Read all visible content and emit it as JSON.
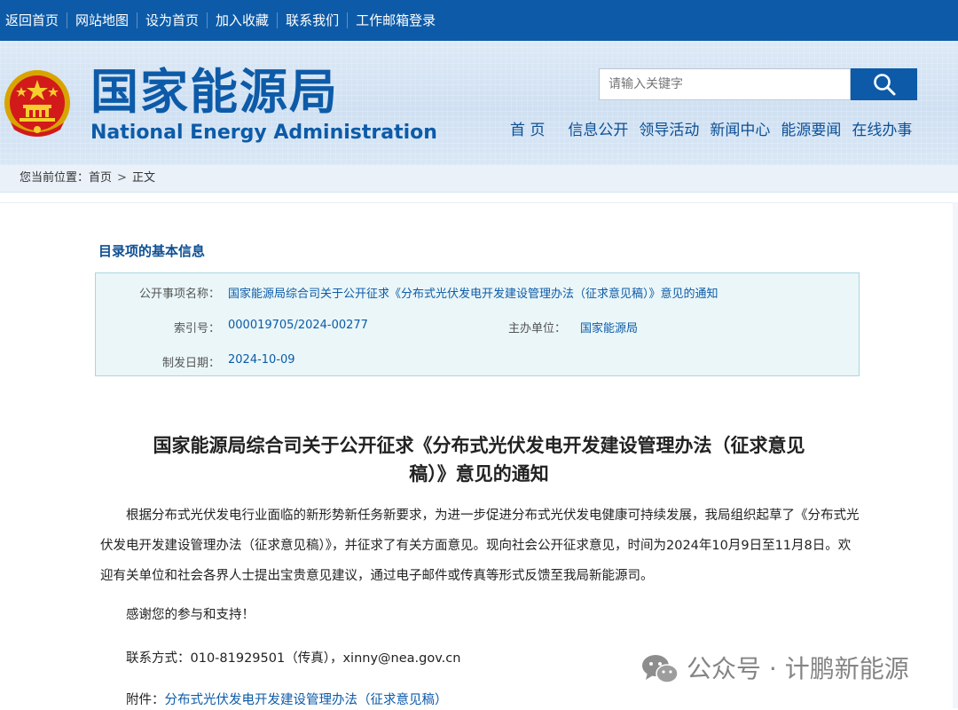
{
  "topbar": {
    "links": [
      "返回首页",
      "网站地图",
      "设为首页",
      "加入收藏",
      "联系我们",
      "工作邮箱登录"
    ]
  },
  "header": {
    "title_cn": "国家能源局",
    "title_en": "National Energy Administration",
    "search_placeholder": "请输入关键字",
    "nav": [
      "首 页",
      "信息公开",
      "领导活动",
      "新闻中心",
      "能源要闻",
      "在线办事"
    ]
  },
  "breadcrumb": {
    "prefix": "您当前位置：",
    "home": "首页",
    "separator": ">",
    "current": "正文"
  },
  "info": {
    "heading": "目录项的基本信息",
    "name_label": "公开事项名称：",
    "name_value": "国家能源局综合司关于公开征求《分布式光伏发电开发建设管理办法（征求意见稿）》意见的通知",
    "index_label": "索引号：",
    "index_value": "000019705/2024-00277",
    "unit_label": "主办单位：",
    "unit_value": "国家能源局",
    "date_label": "制发日期：",
    "date_value": "2024-10-09"
  },
  "article": {
    "title_line1": "国家能源局综合司关于公开征求《分布式光伏发电开发建设管理办法（征求意见",
    "title_line2": "稿）》意见的通知",
    "body": "根据分布式光伏发电行业面临的新形势新任务新要求，为进一步促进分布式光伏发电健康可持续发展，我局组织起草了《分布式光伏发电开发建设管理办法（征求意见稿）》，并征求了有关方面意见。现向社会公开征求意见，时间为2024年10月9日至11月8日。欢迎有关单位和社会各界人士提出宝贵意见建议，通过电子邮件或传真等形式反馈至我局新能源司。",
    "thanks": "感谢您的参与和支持！",
    "contact": "联系方式：010-81929501（传真），xinny@nea.gov.cn",
    "attachment_label": "附件：",
    "attachment_link": "分布式光伏发电开发建设管理办法（征求意见稿）"
  },
  "watermark": {
    "text": "公众号 · 计鹏新能源"
  },
  "colors": {
    "brand_blue": "#0d5ba8",
    "info_bg": "#eaf6f8"
  }
}
